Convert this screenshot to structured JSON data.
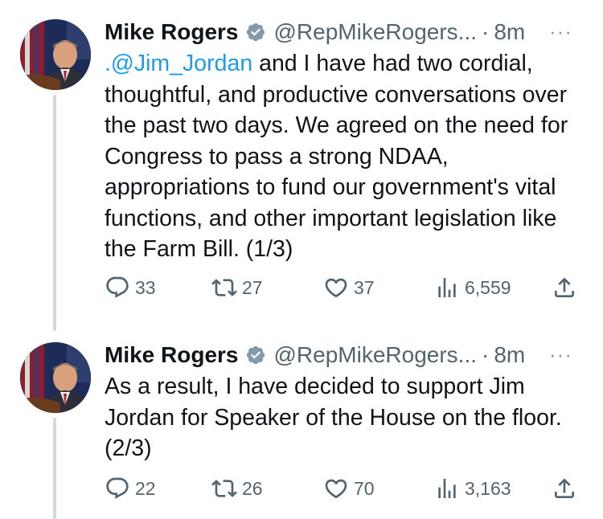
{
  "tweets": [
    {
      "name": "Mike Rogers",
      "handle": "@RepMikeRogers...",
      "dot": "·",
      "time": "8m",
      "more": "···",
      "mention": ".@Jim_Jordan",
      "text": " and I have had two cordial, thoughtful, and productive conversations over the past two days. We agreed on the need for Congress to pass a strong NDAA, appropriations to fund our government's vital functions, and other important legislation like the Farm Bill. (1/3)",
      "replies": "33",
      "retweets": "27",
      "likes": "37",
      "views": "6,559"
    },
    {
      "name": "Mike Rogers",
      "handle": "@RepMikeRogers...",
      "dot": "·",
      "time": "8m",
      "more": "···",
      "text": "As a result, I have decided to support Jim Jordan for Speaker of the House on the floor. (2/3)",
      "replies": "22",
      "retweets": "26",
      "likes": "70",
      "views": "3,163"
    }
  ],
  "colors": {
    "text": "#0f1419",
    "secondary": "#536471",
    "link": "#1d9bf0",
    "verified": "#829aab",
    "thread_line": "#cfd9de"
  }
}
